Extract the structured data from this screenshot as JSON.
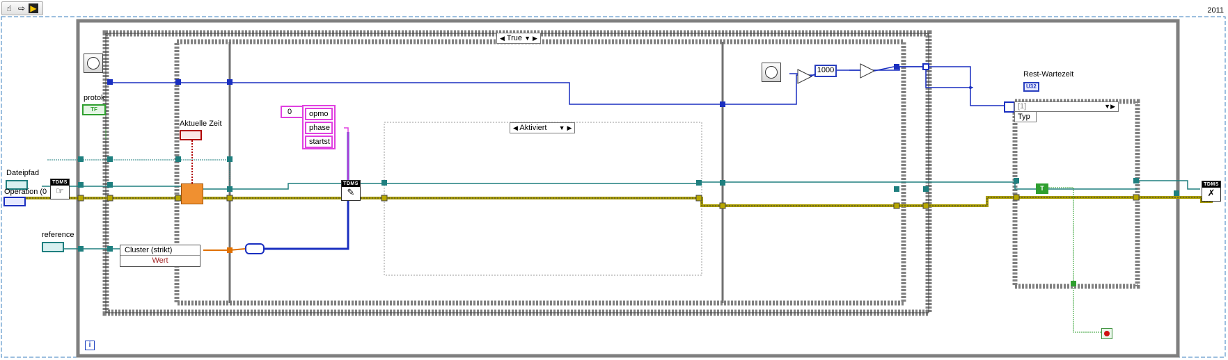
{
  "toolbar": {
    "icons": [
      "operate-hand-icon",
      "run-arrow-icon",
      "labview-icon"
    ]
  },
  "year_label": "2011",
  "structures": {
    "case_selector": "True",
    "inner_case_selector": "Aktiviert",
    "array_index": "[1]",
    "array_label": "Typ"
  },
  "labels": {
    "protok": "protok",
    "aktuelle_zeit": "Aktuelle Zeit",
    "dateipfad": "Dateipfad",
    "operation": "Operation (0",
    "reference": "reference",
    "rest_wartezeit": "Rest-Wartezeit",
    "cluster_strikt": "Cluster (strikt)",
    "wert": "Wert"
  },
  "constants": {
    "tf": "TF",
    "number_zero": "0",
    "thousand": "1000",
    "u32": "U32",
    "true_const": "T",
    "array_items": [
      "opmo",
      "phase",
      "startst"
    ],
    "tdms": "TDMS"
  },
  "colors": {
    "wire_blue": "#1a2fc0",
    "wire_teal": "#1f7f7f",
    "wire_yellow": "#b8a800",
    "wire_pink": "#e040e0",
    "wire_green": "#2f9f2f",
    "wire_orange": "#e07000",
    "frame_gray": "#808080"
  }
}
